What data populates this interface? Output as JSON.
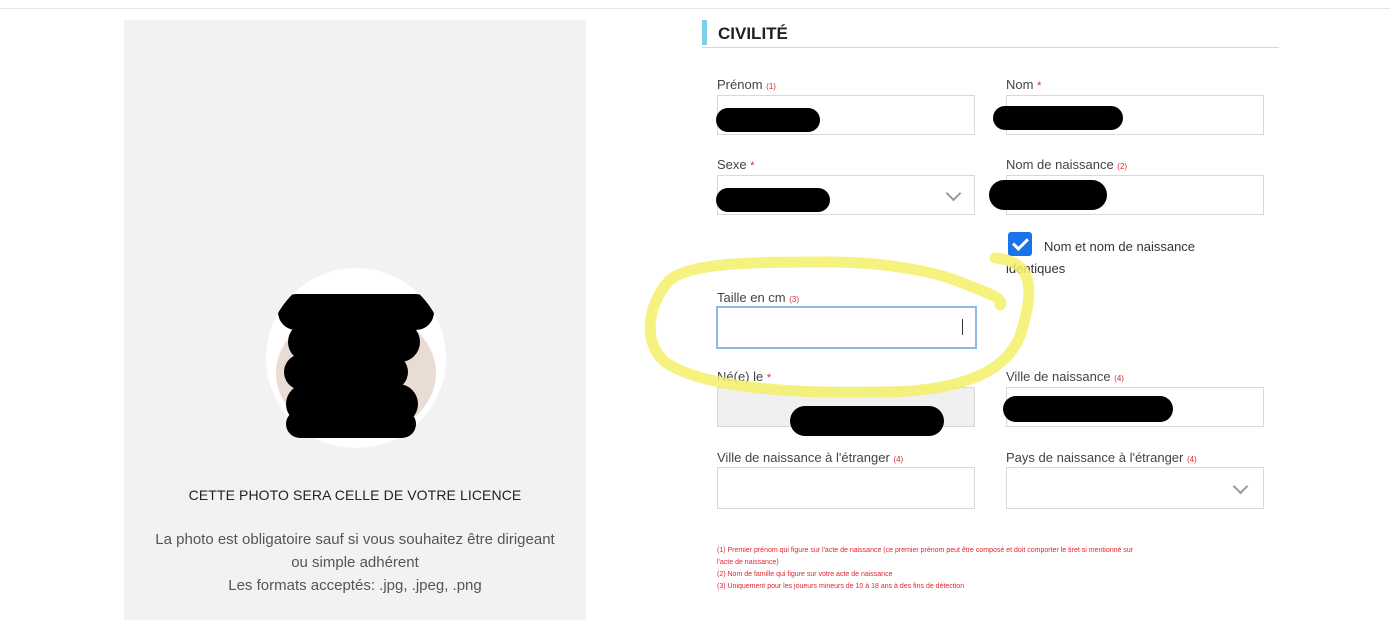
{
  "photo_panel": {
    "title": "CETTE PHOTO SERA CELLE DE VOTRE LICENCE",
    "desc_line1": "La photo est obligatoire sauf si vous souhaitez être dirigeant",
    "desc_line2": "ou simple adhérent",
    "formats": "Les formats acceptés: .jpg, .jpeg, .png"
  },
  "section": {
    "title": "CIVILITÉ"
  },
  "fields": {
    "prenom": {
      "label": "Prénom",
      "ref": "(1)"
    },
    "nom": {
      "label": "Nom",
      "required": "*"
    },
    "sexe": {
      "label": "Sexe",
      "required": "*"
    },
    "nom_naissance": {
      "label": "Nom de naissance",
      "ref": "(2)"
    },
    "checkbox": {
      "label": "Nom et nom de naissance identiques",
      "checked": true
    },
    "taille": {
      "label": "Taille en cm",
      "ref": "(3)",
      "value": ""
    },
    "ne_le": {
      "label": "Né(e) le",
      "required": "*"
    },
    "ville_naissance": {
      "label": "Ville de naissance",
      "ref": "(4)"
    },
    "ville_etranger": {
      "label": "Ville de naissance à l'étranger",
      "ref": "(4)",
      "value": ""
    },
    "pays_etranger": {
      "label": "Pays de naissance à l'étranger",
      "ref": "(4)",
      "value": ""
    }
  },
  "notes": [
    "(1) Premier prénom qui figure sur l'acte de naissance (ce premier prénom peut être composé et doit comporter le tiret si mentionné sur",
    "l'acte de naissance)",
    "(2) Nom de famille qui figure sur votre acte de naissance",
    "(3) Uniquement pour les joueurs mineurs de 10 à 18 ans à des fins de détection"
  ],
  "colors": {
    "accent_bar": "#7dd0e8",
    "required": "#e0262f",
    "checkbox": "#1a73e8",
    "highlight": "#f3f06a"
  }
}
